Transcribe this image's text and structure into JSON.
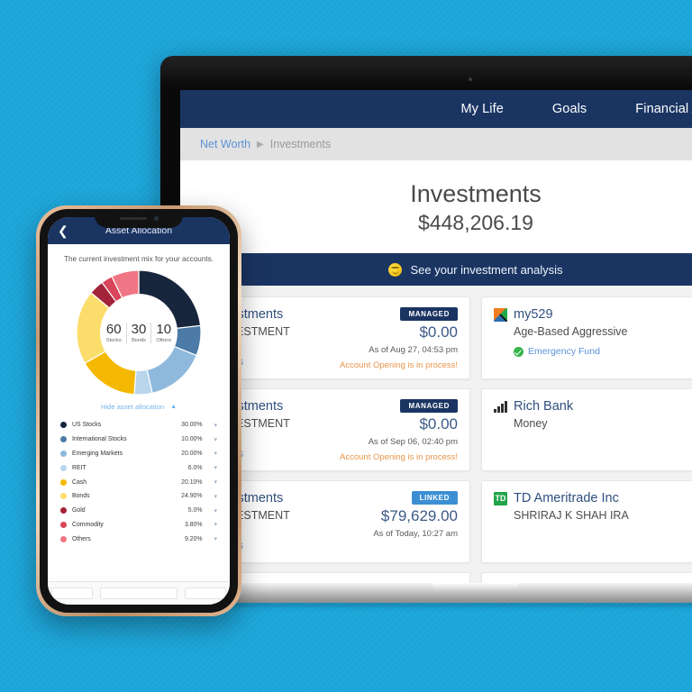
{
  "background": {
    "color": "#1fa8dc"
  },
  "desktop": {
    "nav": {
      "items": [
        {
          "label": "My Life"
        },
        {
          "label": "Goals"
        },
        {
          "label": "Financial Accounts"
        }
      ]
    },
    "breadcrumb": {
      "root": "Net Worth",
      "separator": "▶",
      "current": "Investments"
    },
    "hero": {
      "title": "Investments",
      "amount": "$448,206.19"
    },
    "analysis_banner": {
      "icon": "smiley-icon",
      "label": "See your investment analysis"
    },
    "accounts": [
      {
        "name": "gInvestments",
        "subtitle": "G INVESTMENT",
        "badge": "MANAGED",
        "badge_type": "managed",
        "amount": "$0.00",
        "as_of": "As of Aug 27, 04:53 pm",
        "note": "Account Opening is in process!",
        "link": "It Works"
      },
      {
        "name": "my529",
        "subtitle": "Age-Based Aggressive",
        "logo": "my529-logo",
        "check_label": "Emergency Fund"
      },
      {
        "name": "gInvestments",
        "subtitle": "G INVESTMENT",
        "badge": "MANAGED",
        "badge_type": "managed",
        "amount": "$0.00",
        "as_of": "As of Sep 06, 02:40 pm",
        "note": "Account Opening is in process!",
        "link": "It Works"
      },
      {
        "name": "Rich Bank",
        "subtitle": "Money",
        "logo": "bar-chart-logo"
      },
      {
        "name": "gInvestments",
        "subtitle": "G INVESTMENT",
        "badge": "LINKED",
        "badge_type": "linked",
        "amount": "$79,629.00",
        "as_of": "As of Today, 10:27 am",
        "link": "It Works"
      },
      {
        "name": "TD Ameritrade Inc",
        "subtitle": "SHRIRAJ K SHAH IRA",
        "logo": "td-logo",
        "logo_text": "TD"
      }
    ]
  },
  "phone": {
    "header": {
      "back_icon": "chevron-left-icon",
      "title": "Asset Allocation"
    },
    "caption": "The current investment mix for your accounts.",
    "kpis": [
      {
        "value": "60",
        "label": "Stocks"
      },
      {
        "value": "30",
        "label": "Bonds"
      },
      {
        "value": "10",
        "label": "Others"
      }
    ],
    "hide_link": {
      "label": "Hide asset allocation",
      "icon": "chevron-up-icon"
    },
    "chart_data": {
      "type": "pie",
      "title": "Asset Allocation",
      "legend_position": "below",
      "categories": [
        "US Stocks",
        "International Stocks",
        "Emerging Markets",
        "REIT",
        "Cash",
        "Bonds",
        "Gold",
        "Commodity",
        "Others"
      ],
      "values": [
        30.0,
        10.0,
        20.0,
        6.0,
        20.1,
        24.9,
        5.0,
        3.8,
        9.2
      ],
      "labels": [
        "30.00%",
        "10.00%",
        "20.00%",
        "6.0%",
        "20.10%",
        "24.90%",
        "5.0%",
        "3.80%",
        "9.20%"
      ],
      "colors": [
        "#17263c",
        "#4b7ba6",
        "#8fb9dc",
        "#b8d5ec",
        "#f5b800",
        "#fbdd6b",
        "#a32438",
        "#d9455a",
        "#ef7684"
      ]
    }
  }
}
